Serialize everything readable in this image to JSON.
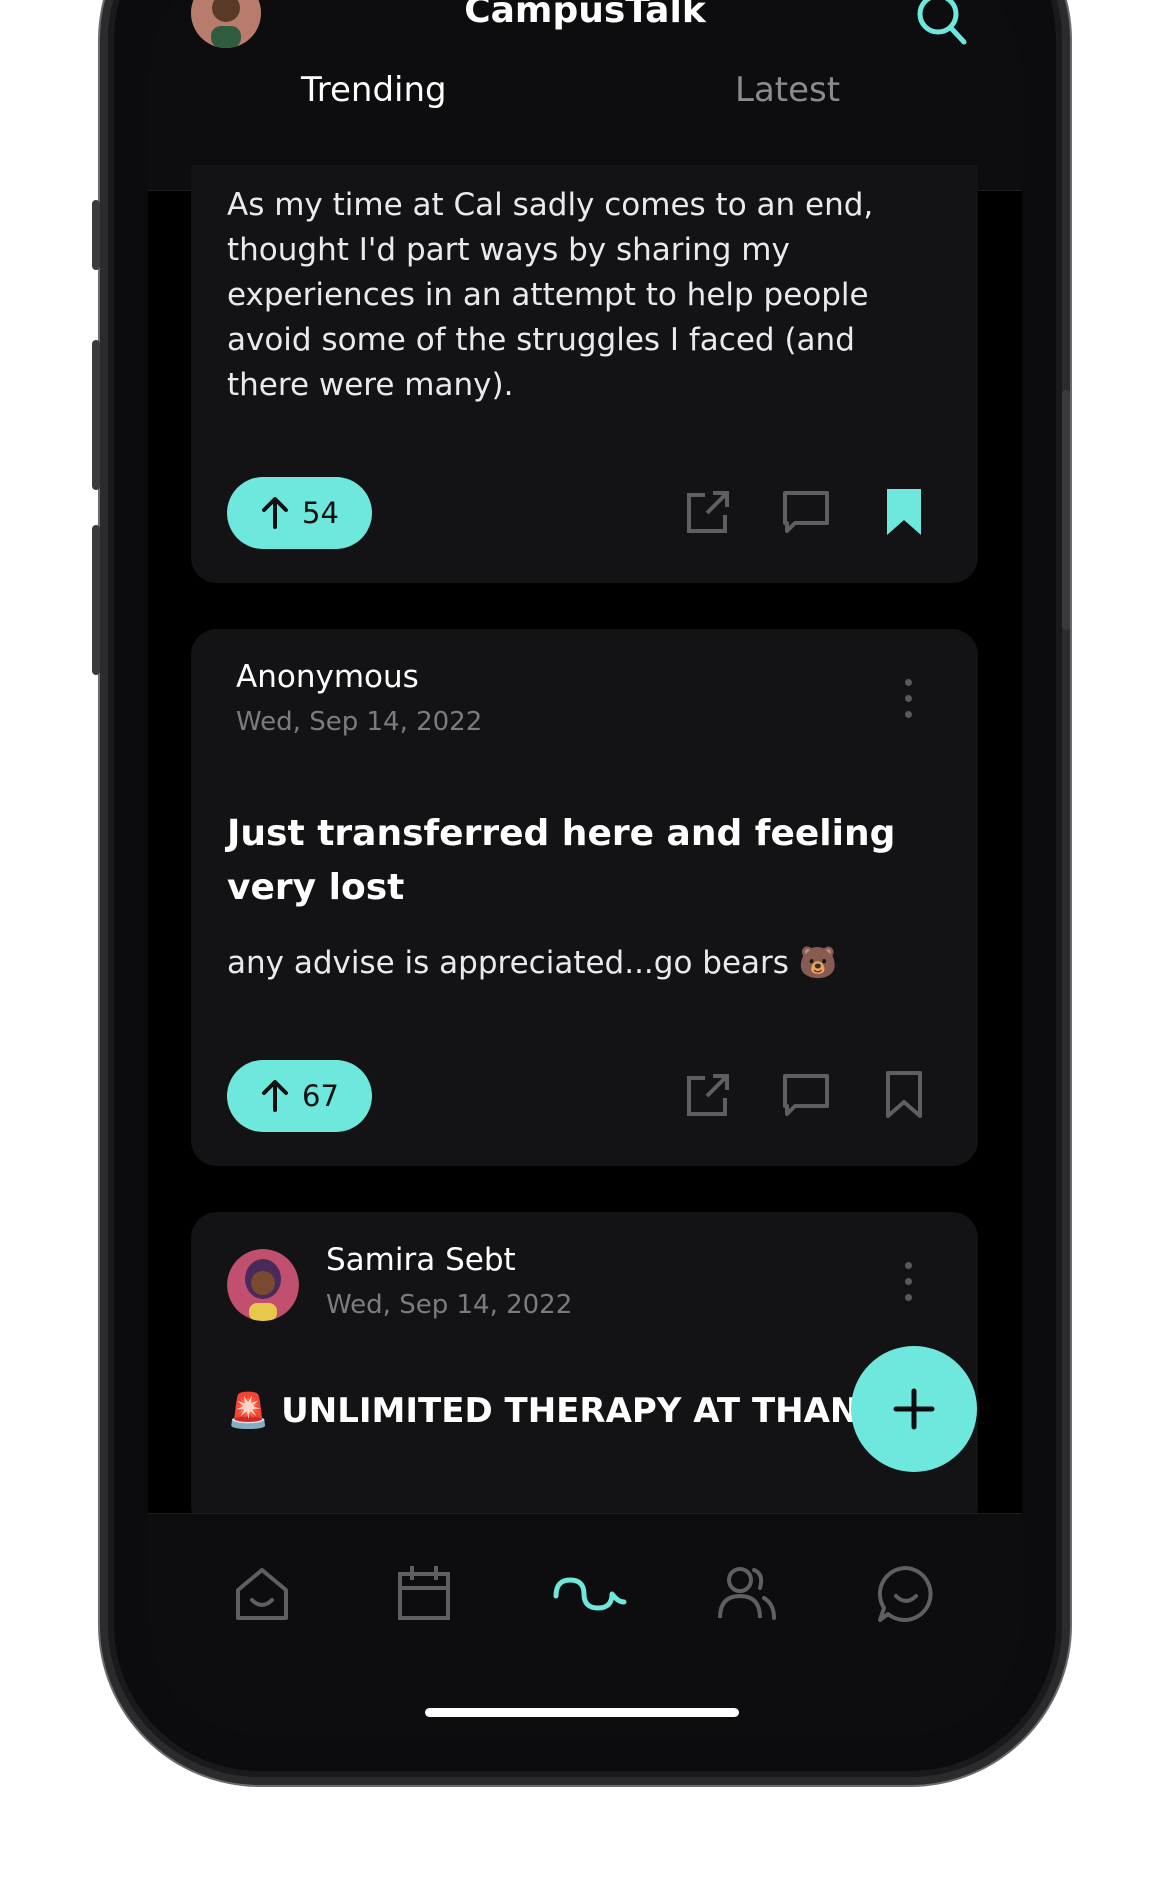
{
  "app": {
    "title": "CampusTalk"
  },
  "tabs": [
    {
      "label": "Trending",
      "active": true
    },
    {
      "label": "Latest",
      "active": false
    }
  ],
  "colors": {
    "accent": "#6ee8dc",
    "background": "#000000",
    "card": "#131316"
  },
  "posts": [
    {
      "body": "As my time at Cal sadly comes to an end, thought I'd part ways by sharing my experiences in an attempt to help people avoid some of the struggles I faced (and there were many).",
      "upvotes": "54",
      "bookmarked": true
    },
    {
      "author": "Anonymous",
      "date": "Wed, Sep 14, 2022",
      "title": "Just transferred here and feeling very lost",
      "body": "any advise is appreciated...go bears 🐻",
      "upvotes": "67",
      "bookmarked": false
    },
    {
      "author": "Samira Sebt",
      "date": "Wed, Sep 14, 2022",
      "title": "🚨 UNLIMITED THERAPY AT THANG 🚨"
    }
  ],
  "icons": {
    "search": "search-icon",
    "upvote": "arrow-up-icon",
    "share": "share-icon",
    "comment": "comment-icon",
    "bookmark": "bookmark-icon",
    "more": "more-vertical-icon",
    "add": "plus-icon"
  },
  "bottom_nav": [
    {
      "name": "home",
      "active": false
    },
    {
      "name": "calendar",
      "active": false
    },
    {
      "name": "feed",
      "active": true
    },
    {
      "name": "people",
      "active": false
    },
    {
      "name": "chat",
      "active": false
    }
  ]
}
